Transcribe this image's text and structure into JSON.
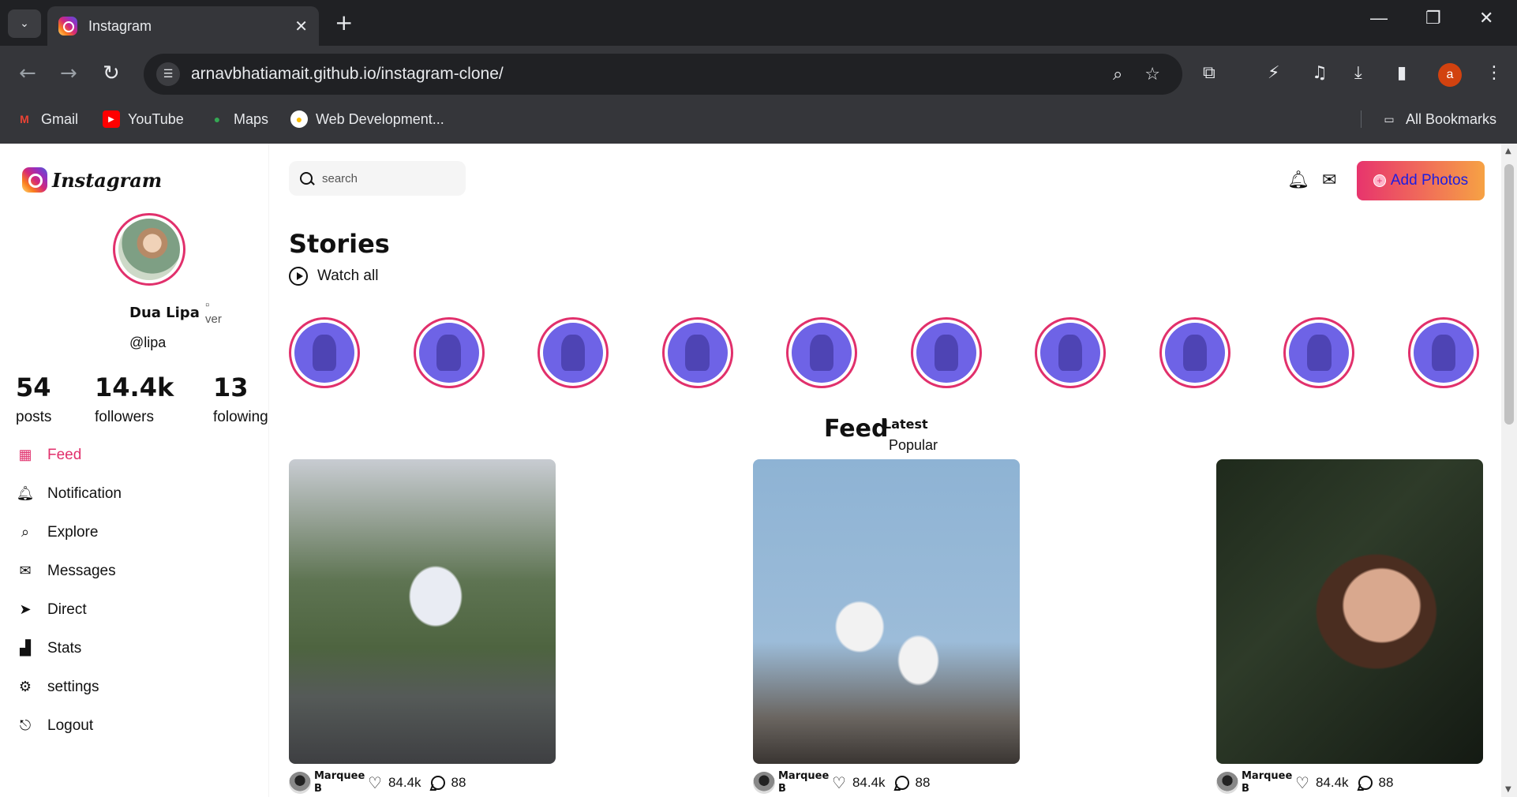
{
  "browser": {
    "tab_title": "Instagram",
    "tab_close": "✕",
    "new_tab": "+",
    "window_controls": [
      "—",
      "❐",
      "✕"
    ],
    "url": "arnavbhatiamait.github.io/instagram-clone/",
    "profile_initial": "a",
    "bookmarks": [
      {
        "label": "Gmail",
        "icon": "gmail-icon",
        "color": "#ea4335"
      },
      {
        "label": "YouTube",
        "icon": "youtube-icon",
        "color": "#ff0000"
      },
      {
        "label": "Maps",
        "icon": "maps-icon",
        "color": "#34a853"
      },
      {
        "label": "Web Development...",
        "icon": "web-dev-icon",
        "color": "#fbbc04"
      }
    ],
    "all_bookmarks": "All Bookmarks"
  },
  "brand": {
    "logo_text": "Instagram",
    "accent": "#e1306c",
    "story_tint": "#6e63e6"
  },
  "profile": {
    "name": "Dua Lipa",
    "verified_alt": "ver",
    "handle": "@lipa",
    "stats": [
      {
        "value": "54",
        "label": "posts"
      },
      {
        "value": "14.4k",
        "label": "followers"
      },
      {
        "value": "13",
        "label": "folowing"
      }
    ]
  },
  "nav": [
    {
      "label": "Feed",
      "icon": "grid-icon"
    },
    {
      "label": "Notification",
      "icon": "bell-icon"
    },
    {
      "label": "Explore",
      "icon": "search-icon"
    },
    {
      "label": "Messages",
      "icon": "mail-icon"
    },
    {
      "label": "Direct",
      "icon": "send-icon"
    },
    {
      "label": "Stats",
      "icon": "bar-chart-icon"
    },
    {
      "label": "settings",
      "icon": "gear-icon"
    },
    {
      "label": "Logout",
      "icon": "logout-icon"
    }
  ],
  "header": {
    "search_placeholder": "search",
    "add_photos": "Add Photos"
  },
  "stories": {
    "title": "Stories",
    "watch_all": "Watch all",
    "count": 10
  },
  "feed": {
    "title": "Feed",
    "latest": "Latest",
    "popular": "Popular",
    "posts": [
      {
        "author": "Marquee B",
        "likes": "84.4k",
        "comments": "88"
      },
      {
        "author": "Marquee B",
        "likes": "84.4k",
        "comments": "88"
      },
      {
        "author": "Marquee B",
        "likes": "84.4k",
        "comments": "88"
      }
    ]
  }
}
